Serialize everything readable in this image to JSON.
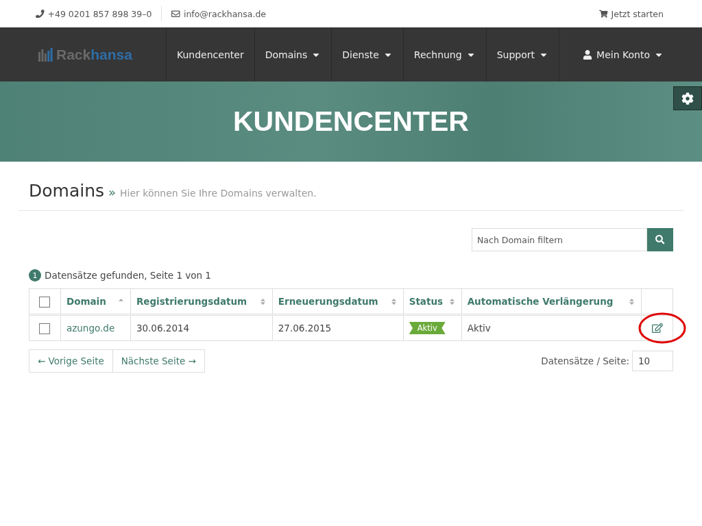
{
  "topbar": {
    "phone": "+49 0201 857 898 39–0",
    "email": "info@rackhansa.de",
    "cta": "Jetzt starten"
  },
  "logo": {
    "first": "Rack",
    "second": "hansa"
  },
  "nav": [
    {
      "label": "Kundencenter",
      "dropdown": false
    },
    {
      "label": "Domains",
      "dropdown": true
    },
    {
      "label": "Dienste",
      "dropdown": true
    },
    {
      "label": "Rechnung",
      "dropdown": true
    },
    {
      "label": "Support",
      "dropdown": true
    }
  ],
  "account": {
    "label": "Mein Konto"
  },
  "hero": {
    "title": "KUNDENCENTER"
  },
  "page": {
    "title": "Domains",
    "separator": "»",
    "subtitle": "Hier können Sie Ihre Domains verwalten."
  },
  "filter": {
    "placeholder": "Nach Domain filtern"
  },
  "summary": {
    "count": "1",
    "text": "Datensätze gefunden, Seite 1 von 1"
  },
  "table": {
    "all_checked": false,
    "columns": [
      {
        "label": "Domain",
        "sorted": true
      },
      {
        "label": "Registrierungsdatum",
        "sorted": false
      },
      {
        "label": "Erneuerungsdatum",
        "sorted": false
      },
      {
        "label": "Status",
        "sorted": false
      },
      {
        "label": "Automatische Verlängerung",
        "sorted": false
      }
    ],
    "rows": [
      {
        "checked": false,
        "domain": "azungo.de",
        "registered": "30.06.2014",
        "renewal": "27.06.2015",
        "status": "Aktiv",
        "auto_renew": "Aktiv",
        "highlighted": true
      }
    ]
  },
  "pager": {
    "prev": "← Vorige Seite",
    "next": "Nächste Seite →",
    "per_page_label": "Datensätze / Seite:",
    "per_page": "10"
  }
}
